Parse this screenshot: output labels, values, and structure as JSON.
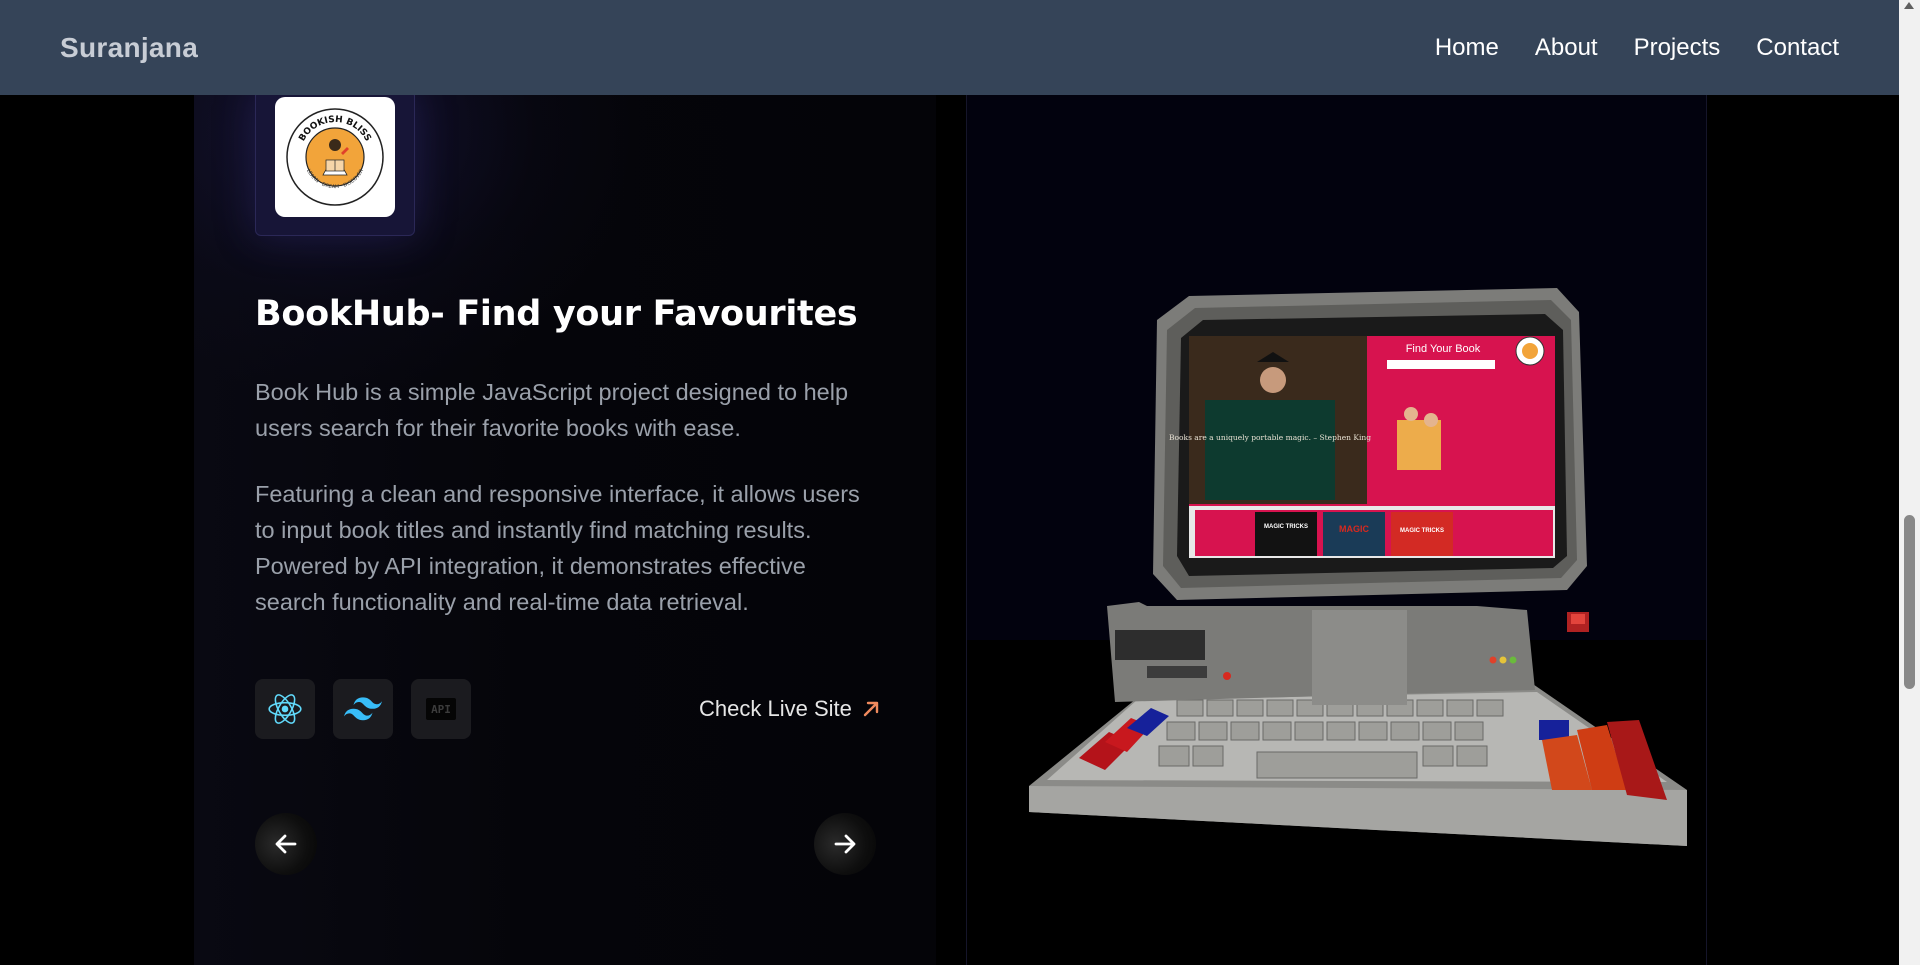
{
  "nav": {
    "brand": "Suranjana",
    "links": [
      "Home",
      "About",
      "Projects",
      "Contact"
    ]
  },
  "project": {
    "logo_text_top": "BOOKISH BLISS",
    "logo_text_bottom": "LEARN · DREAM · DISCOVER",
    "title": "BookHub- Find your Favourites",
    "description_1": "Book Hub is a simple JavaScript project designed to help users search for their favorite books with ease.",
    "description_2": "Featuring a clean and responsive interface, it allows users to input book titles and instantly find matching results. Powered by API integration, it demonstrates effective search functionality and real-time data retrieval.",
    "tech_icons": [
      "react-icon",
      "tailwind-icon",
      "api-icon"
    ],
    "api_label": "API",
    "live_link_label": "Check Live Site"
  },
  "preview": {
    "screen_heading": "Find Your Book",
    "screen_quote": "Books are a uniquely portable magic. – Stephen King",
    "book_titles": [
      "MAGIC TRICKS",
      "MAGIC",
      "MAGIC TRICKS"
    ]
  },
  "colors": {
    "navbar": "#354458",
    "accent_arrow": "#f08a5d",
    "screen_pink": "#d7134f",
    "react": "#61dafb",
    "tailwind": "#38bdf8"
  }
}
